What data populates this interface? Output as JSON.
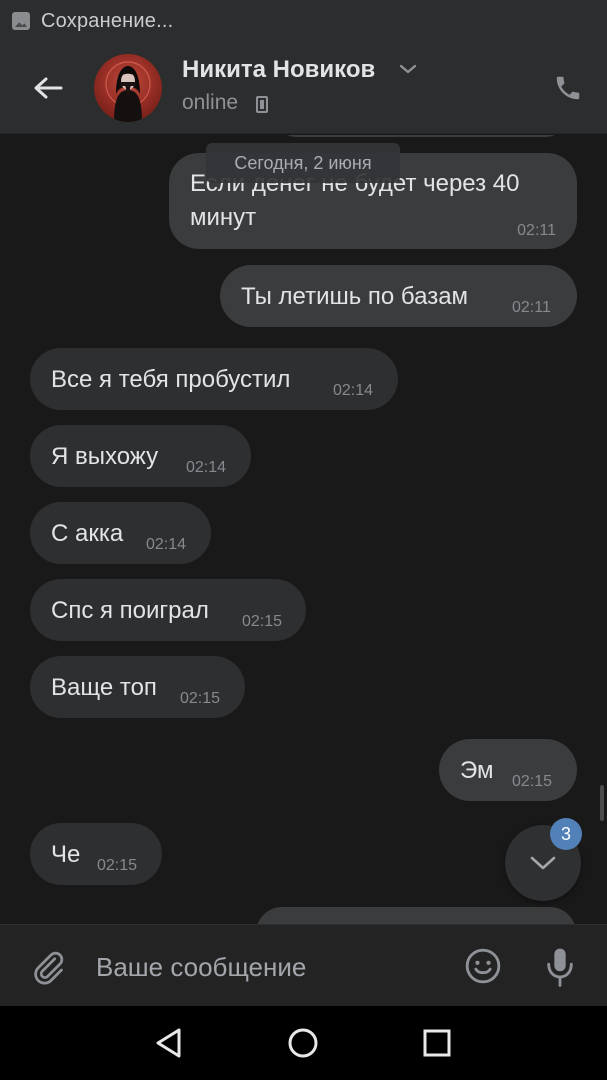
{
  "status_bar": {
    "text": "Сохранение...",
    "icon": "image-icon"
  },
  "header": {
    "name": "Никита Новиков",
    "status": "online",
    "status_icon": "mobile-phone-icon",
    "icons": [
      "back-arrow-icon",
      "chevron-down-icon",
      "phone-icon"
    ]
  },
  "chat": {
    "date_label": "Сегодня, 2 июня",
    "messages": [
      {
        "direction": "out",
        "text": "Если денег не будет через 40 минут",
        "time": "02:11"
      },
      {
        "direction": "out",
        "text": "Ты летишь по базам",
        "time": "02:11"
      },
      {
        "direction": "in",
        "text": "Все я тебя пробустил",
        "time": "02:14"
      },
      {
        "direction": "in",
        "text": "Я выхожу",
        "time": "02:14"
      },
      {
        "direction": "in",
        "text": "С акка",
        "time": "02:14"
      },
      {
        "direction": "in",
        "text": "Спс я поиграл",
        "time": "02:15"
      },
      {
        "direction": "in",
        "text": "Ваще топ",
        "time": "02:15"
      },
      {
        "direction": "out",
        "text": "Эм",
        "time": "02:15"
      },
      {
        "direction": "in",
        "text": "Че",
        "time": "02:15"
      }
    ],
    "unread_count": "3"
  },
  "composer": {
    "placeholder": "Ваше сообщение",
    "icons": [
      "paperclip-icon",
      "smiley-icon",
      "microphone-icon"
    ]
  },
  "colors": {
    "background": "#19191a",
    "header": "#2c2d2e",
    "bubble_in": "#2e2f30",
    "bubble_out": "#3b3c3d",
    "accent_badge": "#5181b8"
  }
}
